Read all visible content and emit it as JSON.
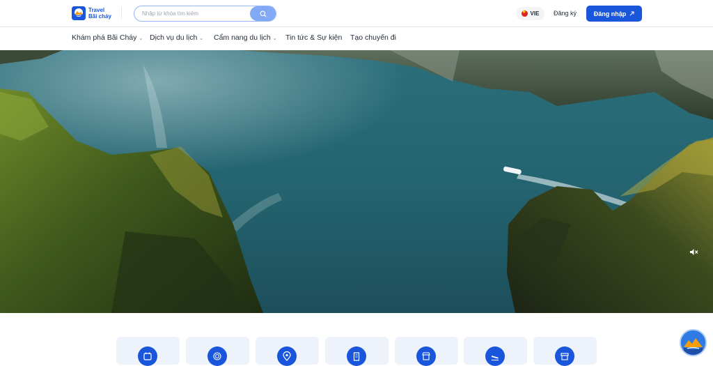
{
  "header": {
    "logo_line1": "Travel",
    "logo_line2": "Bãi cháy",
    "search_placeholder": "Nhập từ khóa tìm kiếm",
    "language": "VIE",
    "signup_label": "Đăng ký",
    "login_label": "Đăng nhập"
  },
  "nav": {
    "items": [
      {
        "label": "Khám phá Bãi Cháy",
        "has_dropdown": true
      },
      {
        "label": "Dịch vụ du lịch",
        "has_dropdown": true
      },
      {
        "label": "Cẩm nang du lịch",
        "has_dropdown": true
      },
      {
        "label": "Tin tức & Sự kiện",
        "has_dropdown": false
      },
      {
        "label": "Tạo chuyến đi",
        "has_dropdown": false
      }
    ]
  },
  "icons": {
    "search": "search-icon",
    "login_arrow": "arrow-up-right-icon",
    "mute": "volume-mute-icon",
    "tiles": [
      "calendar-star-icon",
      "fingerprint-icon",
      "map-pin-icon",
      "building-icon",
      "storefront-icon",
      "plane-arrival-icon",
      "market-stall-icon"
    ]
  },
  "colors": {
    "primary": "#1a56db",
    "tile_bg": "#eef3fb",
    "search_btn": "#82a9f5"
  }
}
